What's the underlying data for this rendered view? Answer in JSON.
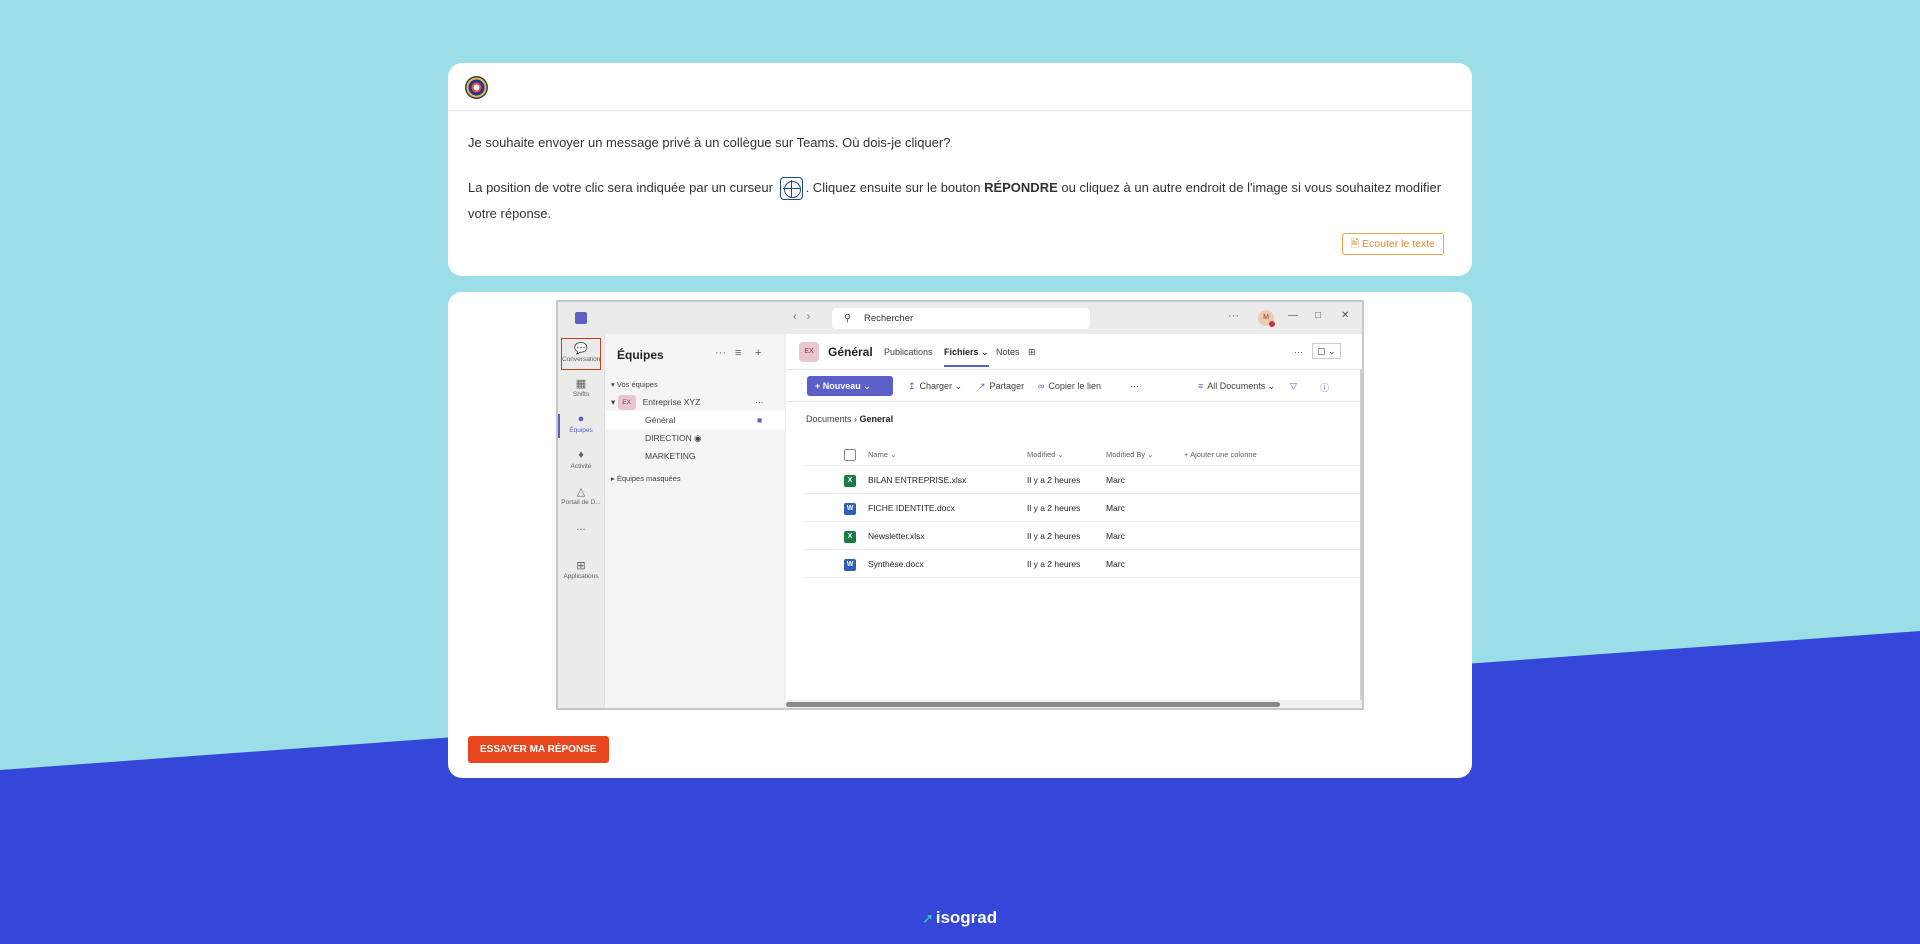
{
  "question": {
    "text": "Je souhaite envoyer un message privé à un collègue sur Teams. Où dois-je cliquer?",
    "instr_before": "La position de votre clic sera indiquée par un curseur ",
    "instr_middle": ". Cliquez ensuite sur le bouton ",
    "instr_bold": "RÉPONDRE",
    "instr_after": " ou cliquez à un autre endroit de l'image si vous souhaitez modifier votre réponse.",
    "listen_label": "Ecouter le texte"
  },
  "try_label": "ESSAYER MA RÉPONSE",
  "brand": "isograd",
  "teams": {
    "search_placeholder": "Rechercher",
    "avatar_initial": "M",
    "rail": [
      {
        "label": "Conversation",
        "icon": "chat-icon"
      },
      {
        "label": "Shifts",
        "icon": "shifts-icon"
      },
      {
        "label": "Équipes",
        "icon": "teams-icon"
      },
      {
        "label": "Activité",
        "icon": "bell-icon"
      },
      {
        "label": "Portail de D...",
        "icon": "portal-icon"
      },
      {
        "label": "...",
        "icon": "more-icon"
      },
      {
        "label": "Applications",
        "icon": "apps-icon"
      }
    ],
    "teamlist": {
      "title": "Équipes",
      "your_teams": "Vos équipes",
      "team_badge": "EX",
      "team_name": "Entreprise XYZ",
      "channels": [
        "Général",
        "DIRECTION",
        "MARKETING"
      ],
      "hidden_teams": "Équipes masquées"
    },
    "channel": {
      "badge": "EX",
      "title": "Général",
      "tabs": [
        "Publications",
        "Fichiers",
        "Notes"
      ]
    },
    "toolbar": {
      "new_label": "Nouveau",
      "upload": "Charger",
      "share": "Partager",
      "copy_link": "Copier le lien",
      "view": "All Documents"
    },
    "breadcrumb": {
      "root": "Documents",
      "current": "General"
    },
    "columns": {
      "name": "Name",
      "modified": "Modified",
      "modified_by": "Modified By",
      "add": "Ajouter une colonne"
    },
    "files": [
      {
        "name": "BILAN ENTREPRISE.xlsx",
        "type": "xlsx",
        "modified": "Il y a 2 heures",
        "by": "Marc"
      },
      {
        "name": "FICHE IDENTITE.docx",
        "type": "docx",
        "modified": "Il y a 2 heures",
        "by": "Marc"
      },
      {
        "name": "Newsletter.xlsx",
        "type": "xlsx",
        "modified": "Il y a 2 heures",
        "by": "Marc"
      },
      {
        "name": "Synthèse.docx",
        "type": "docx",
        "modified": "Il y a 2 heures",
        "by": "Marc"
      }
    ]
  }
}
